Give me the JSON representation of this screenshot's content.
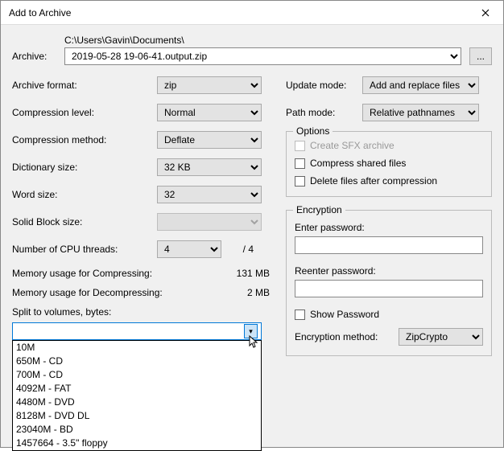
{
  "window": {
    "title": "Add to Archive"
  },
  "archive": {
    "label": "Archive:",
    "path": "C:\\Users\\Gavin\\Documents\\",
    "filename": "2019-05-28 19-06-41.output.zip",
    "browse": "..."
  },
  "left": {
    "format_label": "Archive format:",
    "format_value": "zip",
    "level_label": "Compression level:",
    "level_value": "Normal",
    "method_label": "Compression method:",
    "method_value": "Deflate",
    "dict_label": "Dictionary size:",
    "dict_value": "32 KB",
    "word_label": "Word size:",
    "word_value": "32",
    "block_label": "Solid Block size:",
    "block_value": "",
    "threads_label": "Number of CPU threads:",
    "threads_value": "4",
    "threads_max": "/ 4",
    "mem_compress_label": "Memory usage for Compressing:",
    "mem_compress_value": "131 MB",
    "mem_decompress_label": "Memory usage for Decompressing:",
    "mem_decompress_value": "2 MB",
    "split_label": "Split to volumes, bytes:",
    "split_value": "",
    "split_options": [
      "10M",
      "650M - CD",
      "700M - CD",
      "4092M - FAT",
      "4480M - DVD",
      "8128M - DVD DL",
      "23040M - BD",
      "1457664 - 3.5\" floppy"
    ]
  },
  "right": {
    "update_label": "Update mode:",
    "update_value": "Add and replace files",
    "path_label": "Path mode:",
    "path_value": "Relative pathnames",
    "options_legend": "Options",
    "opt_sfx": "Create SFX archive",
    "opt_shared": "Compress shared files",
    "opt_delete": "Delete files after compression",
    "enc_legend": "Encryption",
    "enter_pw": "Enter password:",
    "reenter_pw": "Reenter password:",
    "show_pw": "Show Password",
    "enc_method_label": "Encryption method:",
    "enc_method_value": "ZipCrypto"
  }
}
